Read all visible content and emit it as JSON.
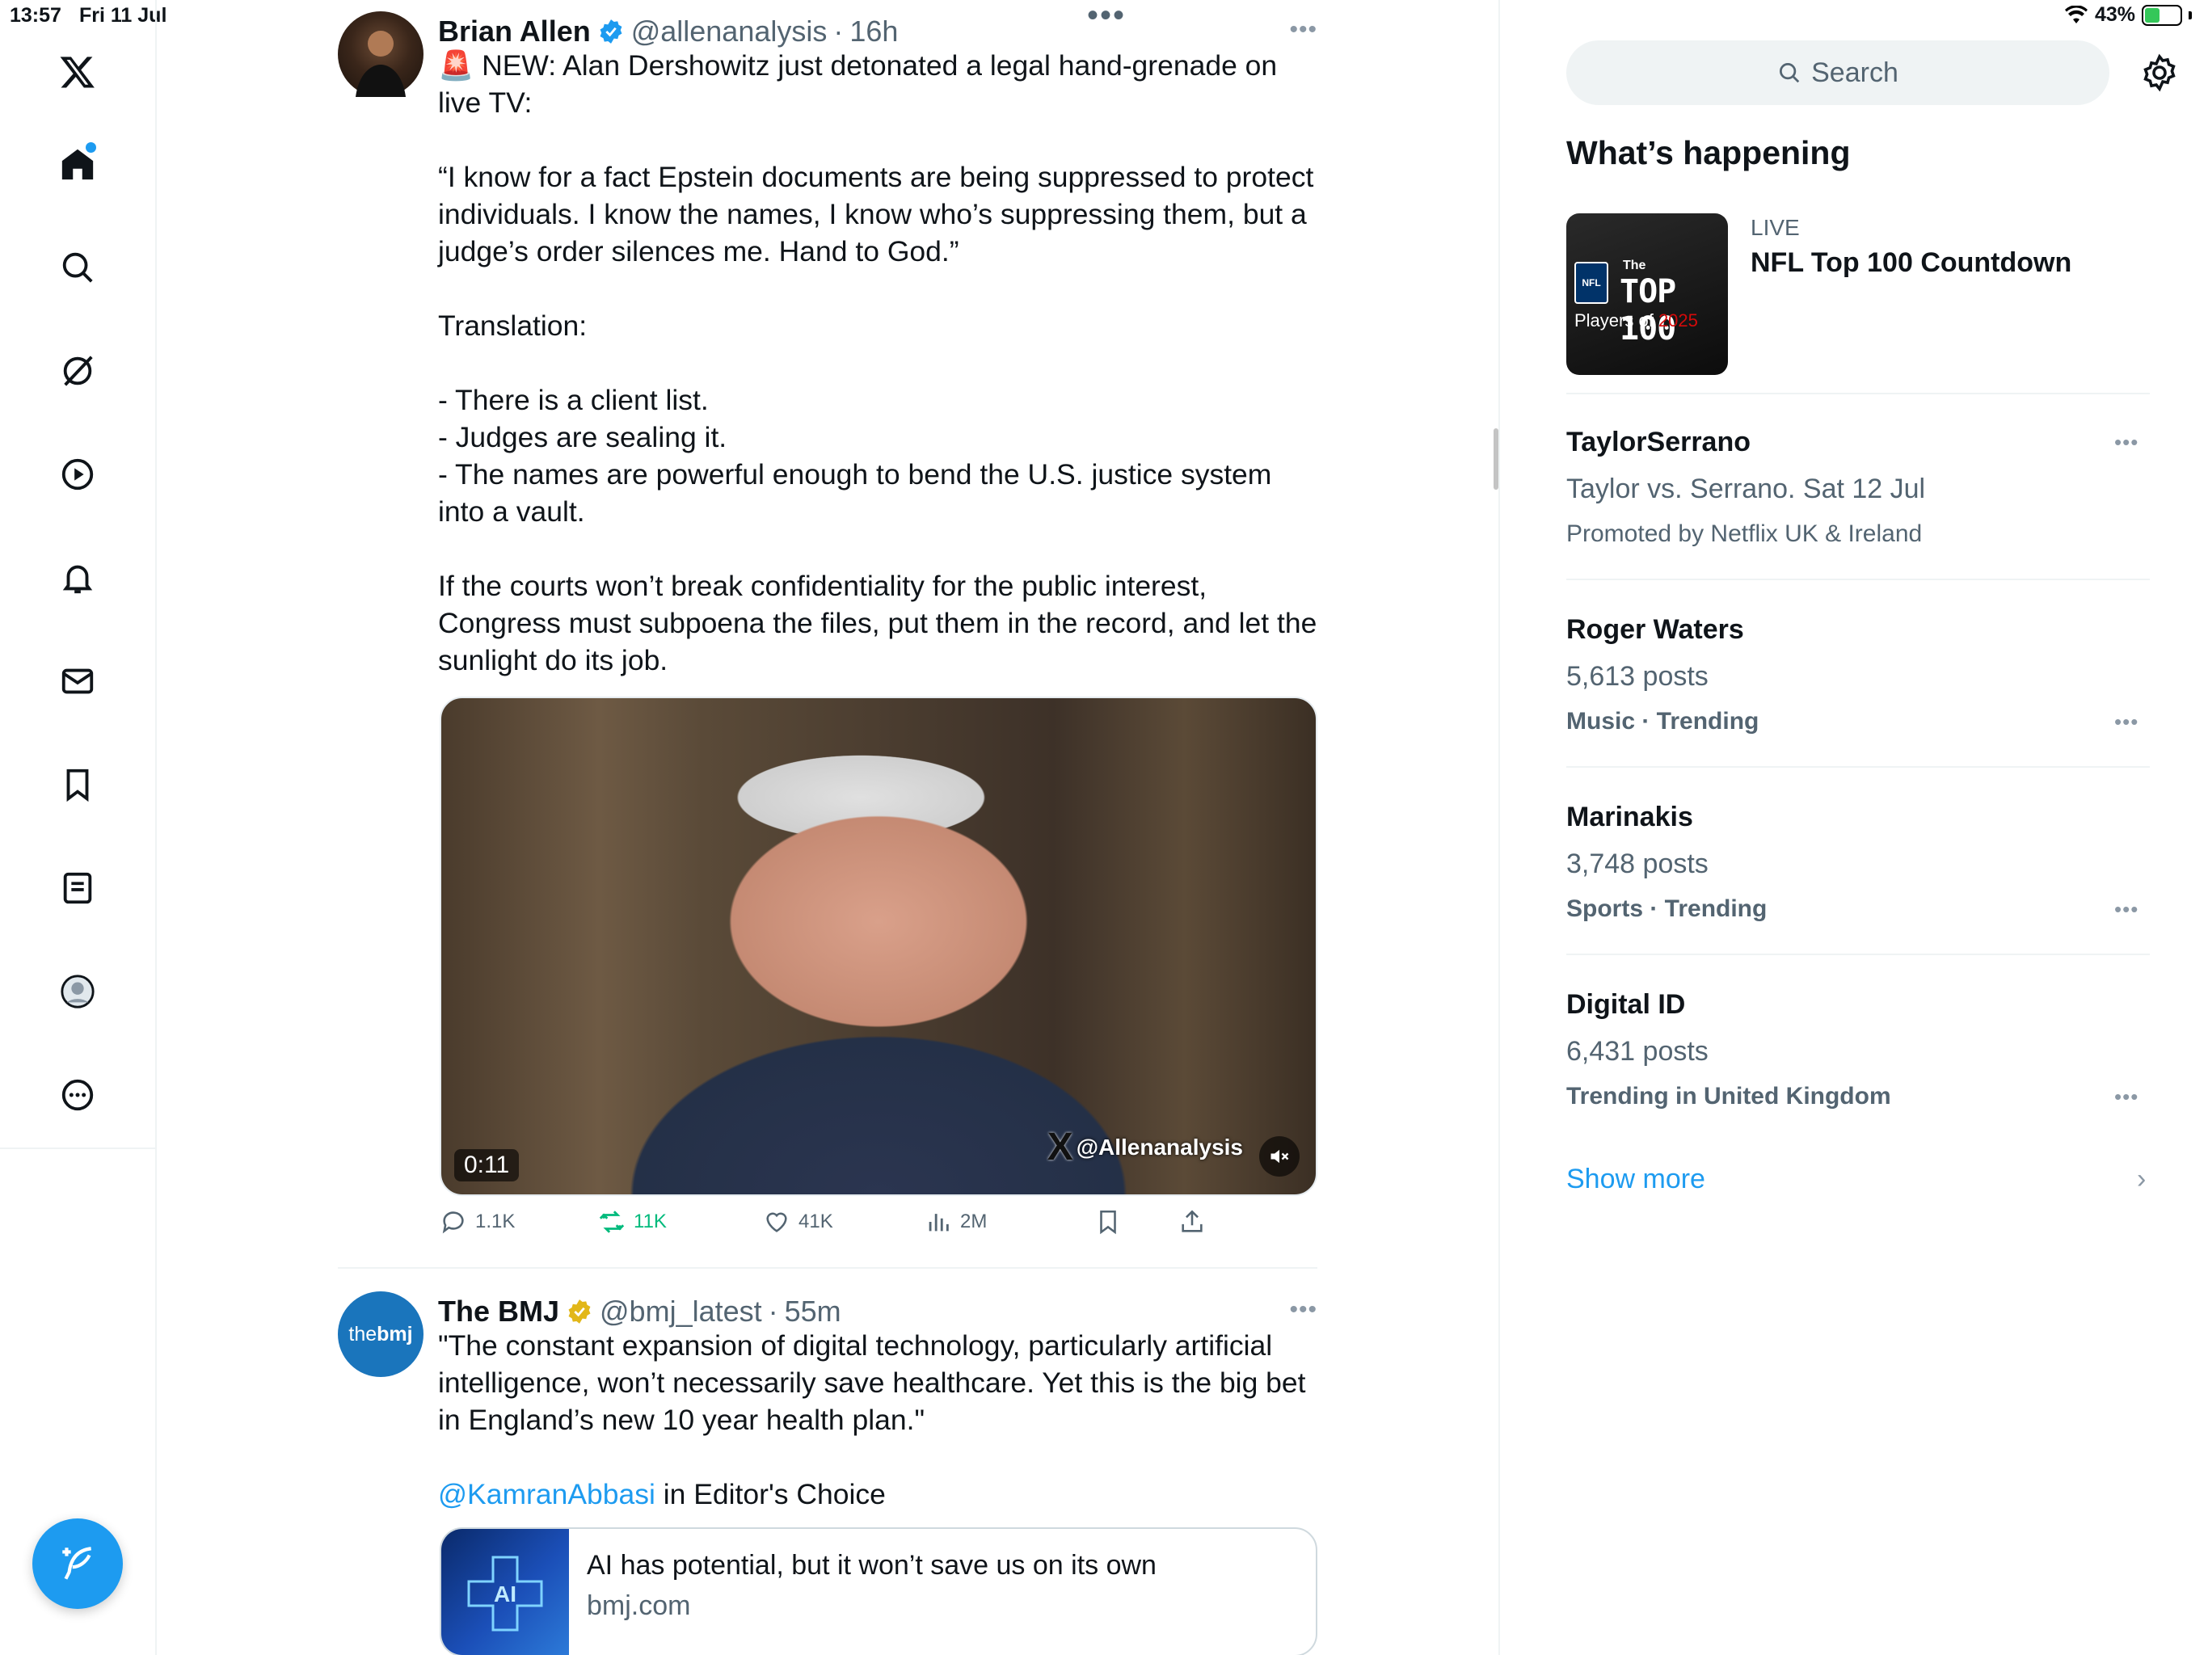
{
  "status_bar": {
    "time": "13:57",
    "date": "Fri 11 Jul",
    "battery": "43%",
    "battery_level": 0.43
  },
  "nav": {
    "items": [
      "x-logo-icon",
      "home-icon",
      "search-icon",
      "grok-icon",
      "video-icon",
      "notifications-icon",
      "messages-icon",
      "bookmarks-icon",
      "lists-icon",
      "profile-icon",
      "more-icon"
    ],
    "compose_icon": "compose-icon"
  },
  "tweets": [
    {
      "name": "Brian Allen",
      "handle": "@allenanalysis",
      "time": "16h",
      "paragraphs": [
        "🚨 NEW: Alan Dershowitz just detonated a legal hand-grenade on live TV:",
        "“I know for a fact Epstein documents are being suppressed to protect individuals. I know the names, I know who’s suppressing them, but a judge’s order silences me. Hand to God.”",
        "Translation:",
        "- There is a client list.\n- Judges are sealing it.\n- The names are powerful enough to bend the U.S. justice system into a vault.",
        "If the courts won’t break confidentiality for the public interest, Congress must subpoena the files, put them in the record, and let the sunlight do its job."
      ],
      "video": {
        "duration": "0:11",
        "watermark": "@Allenanalysis"
      },
      "stats": {
        "replies": "1.1K",
        "reposts": "11K",
        "likes": "41K",
        "views": "2M"
      }
    },
    {
      "name": "The BMJ",
      "handle": "@bmj_latest",
      "time": "55m",
      "avatar_text_a": "the",
      "avatar_text_b": "bmj",
      "text": "\"The constant expansion of digital technology, particularly artificial intelligence, won’t necessarily save healthcare. Yet this is the big bet in England’s new 10 year health plan.\"",
      "mention": "@KamranAbbasi",
      "mention_suffix": " in Editor's Choice",
      "card": {
        "title": "AI has potential, but it won’t save us on its own",
        "domain": "bmj.com",
        "thumb_text": "AI"
      }
    }
  ],
  "sidebar": {
    "search_placeholder": "Search",
    "section_title": "What’s happening",
    "live": {
      "label": "LIVE",
      "title": "NFL Top 100 Countdown",
      "img_nfl": "NFL",
      "img_the": "The",
      "img_top": "TOP 100",
      "img_players": "Players of ",
      "img_year": "2025"
    },
    "trends": [
      {
        "name": "TaylorSerrano",
        "sub": "Taylor vs. Serrano. Sat 12 Jul",
        "meta": "Promoted by Netflix UK & Ireland",
        "promoted": true
      },
      {
        "name": "Roger Waters",
        "sub": "5,613 posts",
        "meta": "Music · Trending",
        "promoted": false
      },
      {
        "name": "Marinakis",
        "sub": "3,748 posts",
        "meta": "Sports · Trending",
        "promoted": false
      },
      {
        "name": "Digital ID",
        "sub": "6,431 posts",
        "meta": "Trending in United Kingdom",
        "promoted": false
      }
    ],
    "show_more": "Show more"
  },
  "colors": {
    "accent": "#1d9bf0",
    "repost_green": "#00ba7c",
    "verified_gold": "#e2b719",
    "muted": "#536471"
  }
}
